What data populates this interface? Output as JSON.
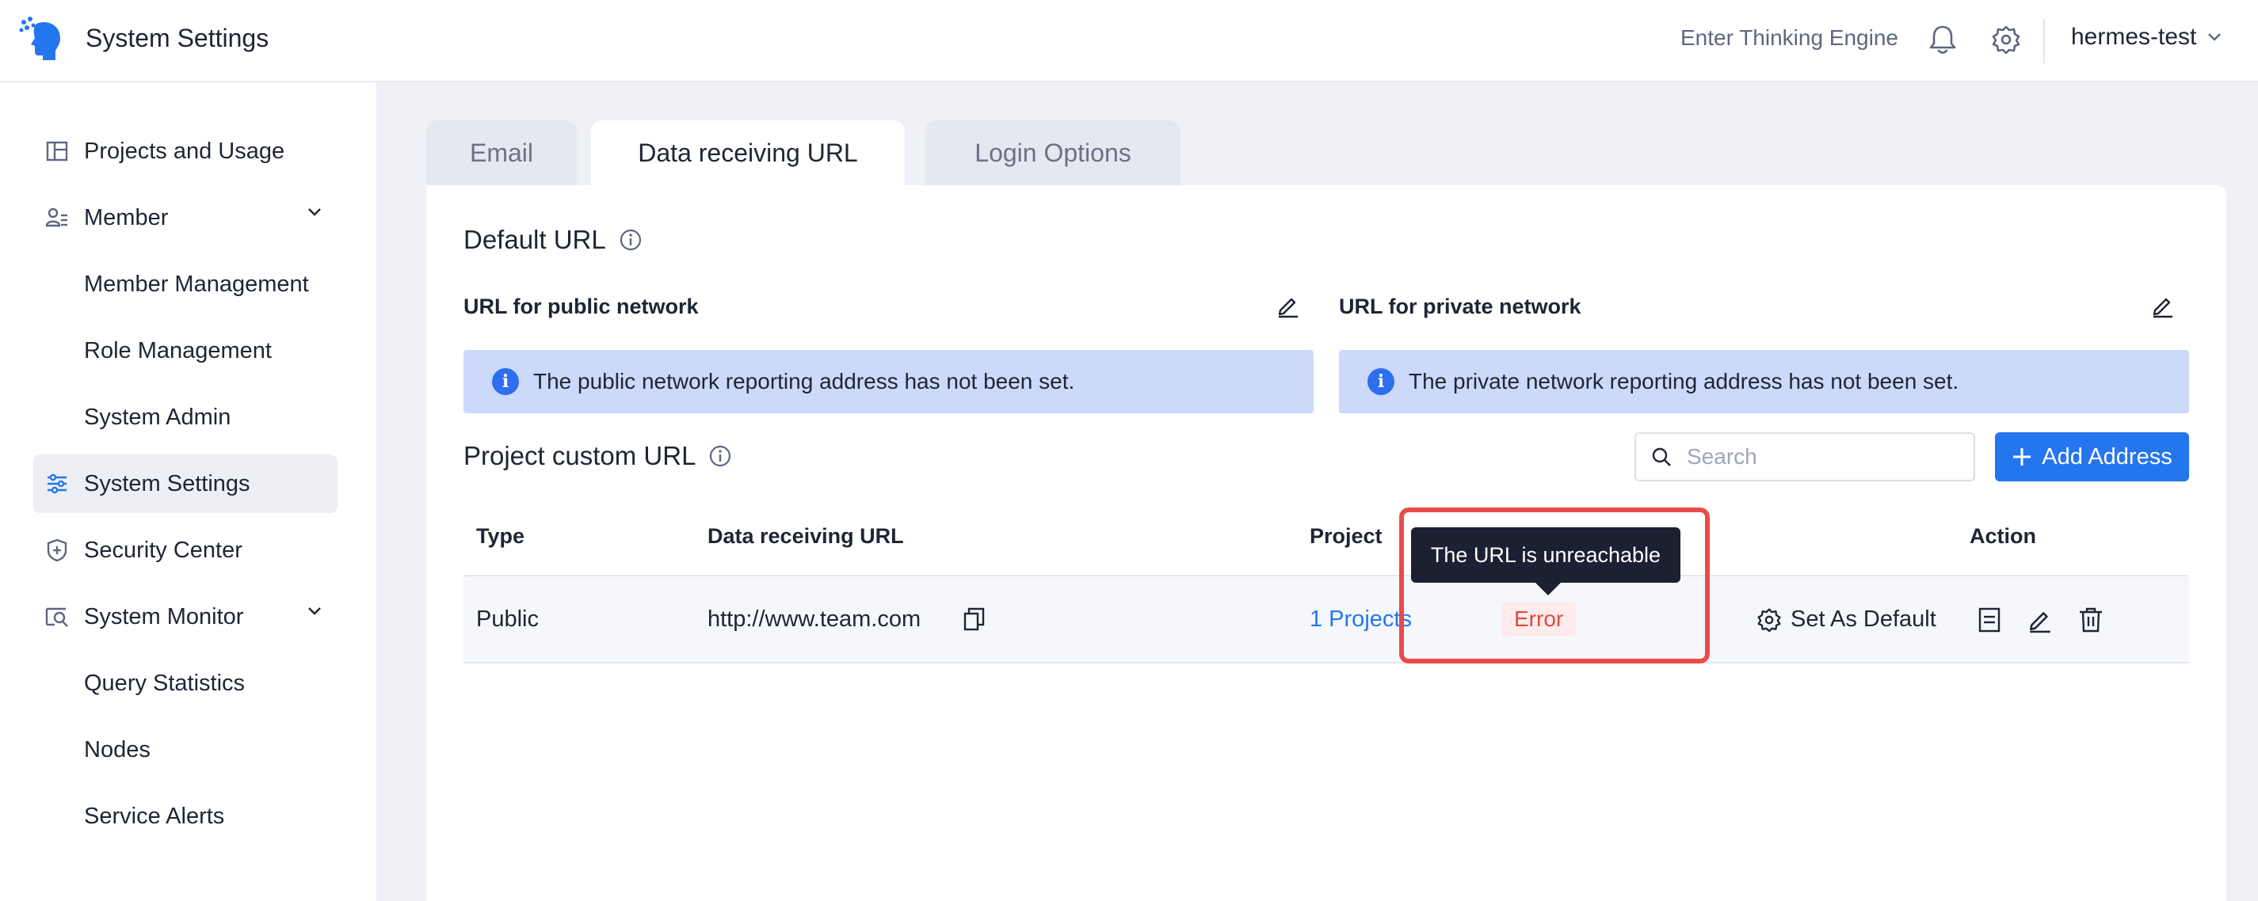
{
  "header": {
    "app_title": "System Settings",
    "enter_link": "Enter Thinking Engine",
    "bell_icon": "bell-icon",
    "settings_icon": "gear-icon",
    "user_name": "hermes-test",
    "brand_color": "#2476ef"
  },
  "sidebar": {
    "items": [
      {
        "label": "Projects and Usage",
        "icon": "layout-icon"
      },
      {
        "label": "Member",
        "icon": "members-icon"
      },
      {
        "label": "Member Management"
      },
      {
        "label": "Role Management"
      },
      {
        "label": "System Admin"
      },
      {
        "label": "System Settings",
        "icon": "sliders-icon",
        "active": true
      },
      {
        "label": "Security Center",
        "icon": "shield-icon"
      },
      {
        "label": "System Monitor",
        "icon": "monitor-search-icon"
      },
      {
        "label": "Query Statistics"
      },
      {
        "label": "Nodes"
      },
      {
        "label": "Service Alerts"
      }
    ]
  },
  "tabs": [
    {
      "label": "Email",
      "active": false
    },
    {
      "label": "Data receiving URL",
      "active": true
    },
    {
      "label": "Login Options",
      "active": false
    }
  ],
  "default_url": {
    "title": "Default URL",
    "public_label": "URL for public network",
    "private_label": "URL for private network",
    "public_alert": "The public network reporting address has not been set.",
    "private_alert": "The private network reporting address has not been set."
  },
  "custom_url": {
    "title": "Project custom URL",
    "search_placeholder": "Search",
    "add_button": "Add Address",
    "columns": [
      "Type",
      "Data receiving URL",
      "Project",
      "Action"
    ],
    "rows": [
      {
        "type": "Public",
        "url": "http://www.team.com",
        "project": "1 Projects",
        "status": "Error",
        "set_default": "Set As Default"
      }
    ],
    "tooltip": "The URL is unreachable"
  }
}
